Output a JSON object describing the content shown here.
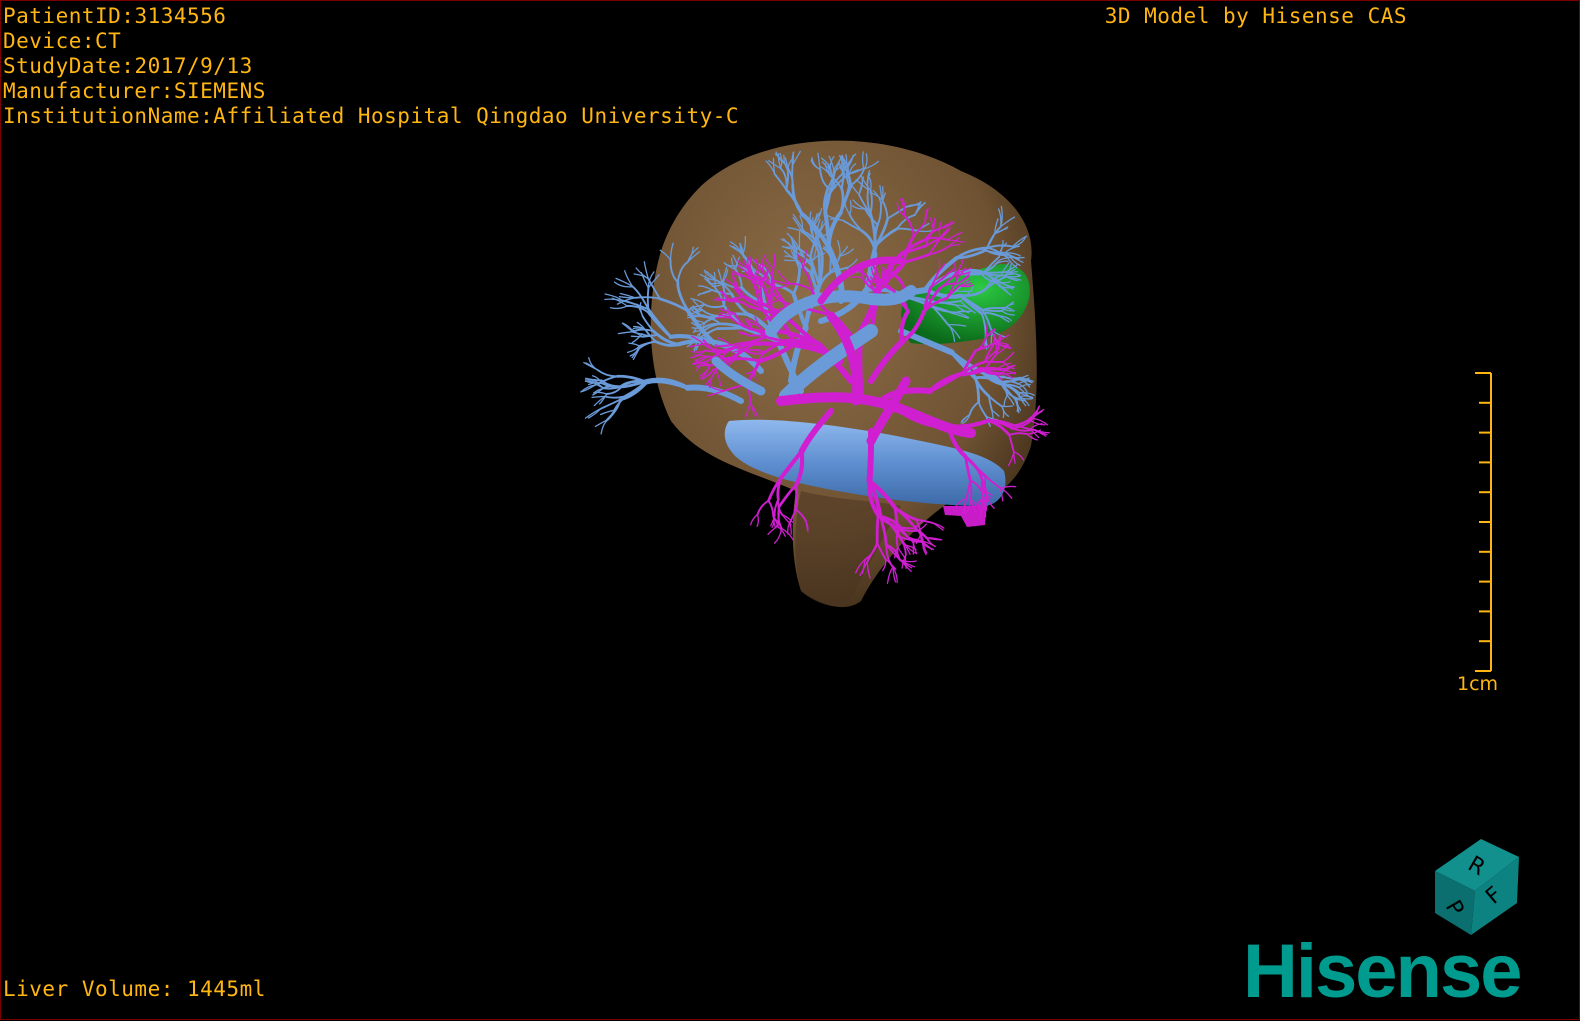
{
  "overlay": {
    "patient_label": "PatientID:",
    "patient_id": "3134556",
    "device_label": "Device:",
    "device": "CT",
    "study_label": "StudyDate:",
    "study_date": "2017/9/13",
    "manufacturer_label": "Manufacturer:",
    "manufacturer": "SIEMENS",
    "institution_label": "InstitutionName:",
    "institution": "Affiliated Hospital Qingdao University-C",
    "credit": "3D Model by Hisense CAS",
    "volume_text": "Liver Volume: 1445ml"
  },
  "scale_bar": {
    "label": "1cm",
    "ticks": 11
  },
  "orientation_cube": {
    "faces": [
      "R",
      "F",
      "P"
    ],
    "color": "#0a7b7b"
  },
  "logo": {
    "text": "Hisense",
    "color": "#009b8f"
  },
  "colors": {
    "overlay_text": "#ffb612",
    "liver": "#8a6a45",
    "portal_vein": "#6a9ad8",
    "hepatic_artery": "#d01fd0",
    "gallbladder": "#11a62a",
    "background": "#000000"
  },
  "model": {
    "structures": [
      "liver",
      "portal vein",
      "hepatic artery",
      "gallbladder",
      "inferior vena cava"
    ]
  }
}
